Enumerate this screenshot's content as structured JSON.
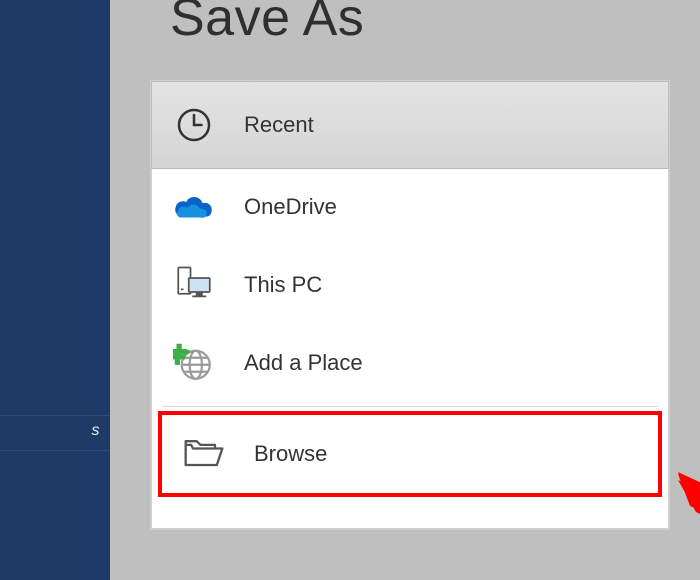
{
  "sidebar": {
    "visible_fragment": "s"
  },
  "title": "Save As",
  "places": {
    "recent": {
      "label": "Recent",
      "selected": true
    },
    "onedrive": {
      "label": "OneDrive",
      "selected": false
    },
    "thispc": {
      "label": "This PC",
      "selected": false
    },
    "addplace": {
      "label": "Add a Place",
      "selected": false
    },
    "browse": {
      "label": "Browse",
      "selected": false,
      "annotated": true
    }
  }
}
